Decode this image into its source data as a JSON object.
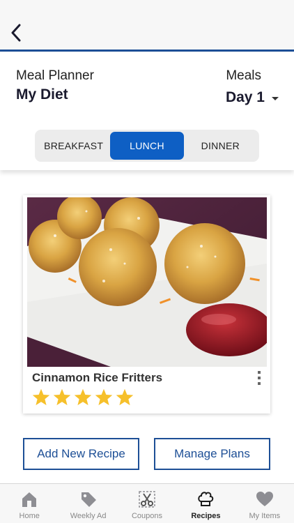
{
  "header": {
    "back_icon": "chevron-left-icon",
    "planner_label": "Meal Planner",
    "diet_name": "My Diet",
    "meals_label": "Meals",
    "day_selected": "Day 1"
  },
  "meal_tabs": {
    "items": [
      {
        "label": "BREAKFAST",
        "active": false
      },
      {
        "label": "LUNCH",
        "active": true
      },
      {
        "label": "DINNER",
        "active": false
      }
    ]
  },
  "recipe_card": {
    "title": "Cinnamon Rice Fritters",
    "rating": 5,
    "rating_max": 5,
    "image_icon": "recipe-photo"
  },
  "actions": {
    "add_label": "Add New Recipe",
    "manage_label": "Manage Plans"
  },
  "tabbar": {
    "items": [
      {
        "label": "Home",
        "icon": "home-icon",
        "active": false
      },
      {
        "label": "Weekly Ad",
        "icon": "tag-icon",
        "active": false
      },
      {
        "label": "Coupons",
        "icon": "scissors-coupon-icon",
        "active": false
      },
      {
        "label": "Recipes",
        "icon": "chef-hat-icon",
        "active": true
      },
      {
        "label": "My Items",
        "icon": "heart-icon",
        "active": false
      }
    ]
  },
  "colors": {
    "brand_blue": "#1d4f96",
    "active_tab": "#0e5fc4",
    "star": "#f6c02b"
  }
}
